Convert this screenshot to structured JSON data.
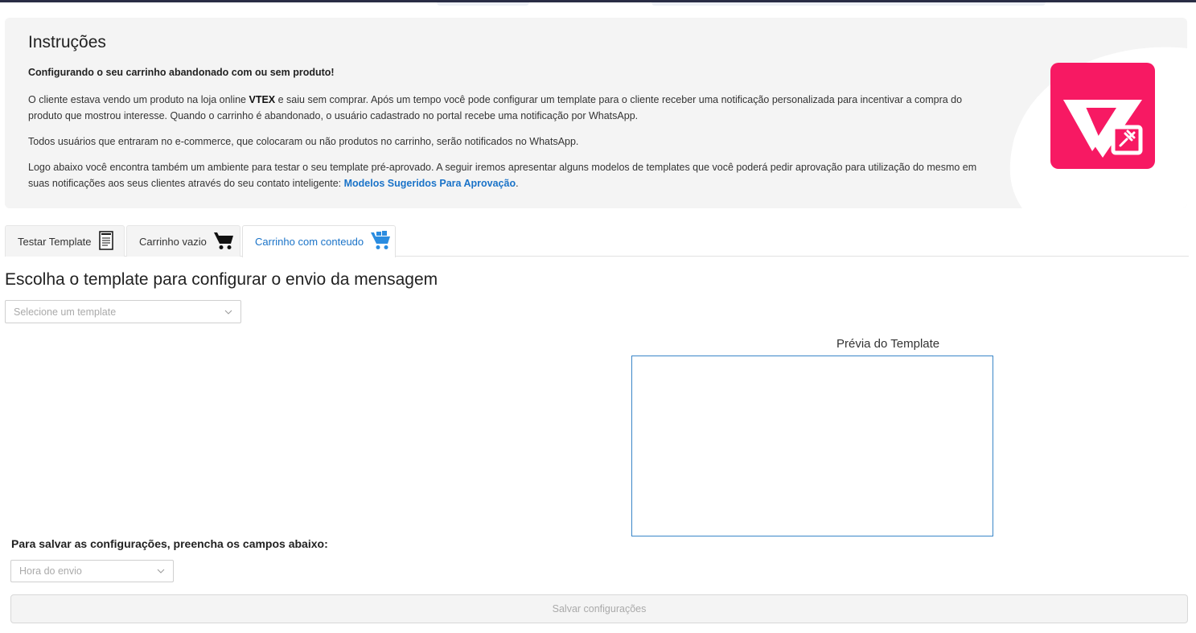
{
  "instructions": {
    "title": "Instruções",
    "subtitle": "Configurando o seu carrinho abandonado com ou sem produto!",
    "p1_before": "O cliente estava vendo um produto na loja online ",
    "p1_brand": "VTEX",
    "p1_after": " e saiu sem comprar. Após um tempo você pode configurar um template para o cliente receber uma notificação personalizada para incentivar a compra do produto que mostrou interesse. Quando o carrinho é abandonado, o usuário cadastrado no portal recebe uma notificação por WhatsApp.",
    "p2": "Todos usuários que entraram no e-commerce, que colocaram ou não produtos no carrinho, serão notificados no WhatsApp.",
    "p3": "Logo abaixo você encontra também um ambiente para testar o seu template pré-aprovado. A seguir iremos apresentar alguns modelos de templates que você poderá pedir aprovação para utilização do mesmo em suas notificações aos seus clientes através do seu contato inteligente: ",
    "p3_link": "Modelos Sugeridos Para Aprovação",
    "p3_end": "."
  },
  "tabs": [
    {
      "label": "Testar Template",
      "icon": "test-document-icon"
    },
    {
      "label": "Carrinho vazio",
      "icon": "cart-icon"
    },
    {
      "label": "Carrinho com conteudo",
      "icon": "cart-full-icon",
      "active": true
    }
  ],
  "colors": {
    "accent": "#1a73c8",
    "logo": "#f71963",
    "preview_border": "#3a86c8"
  },
  "main": {
    "title": "Escolha o template para configurar o envio da mensagem",
    "template_select_placeholder": "Selecione um template",
    "preview_label": "Prévia do Template",
    "save_section_label": "Para salvar as configurações, preencha os campos abaixo:",
    "hour_select_placeholder": "Hora do envio",
    "save_button_label": "Salvar configurações"
  }
}
